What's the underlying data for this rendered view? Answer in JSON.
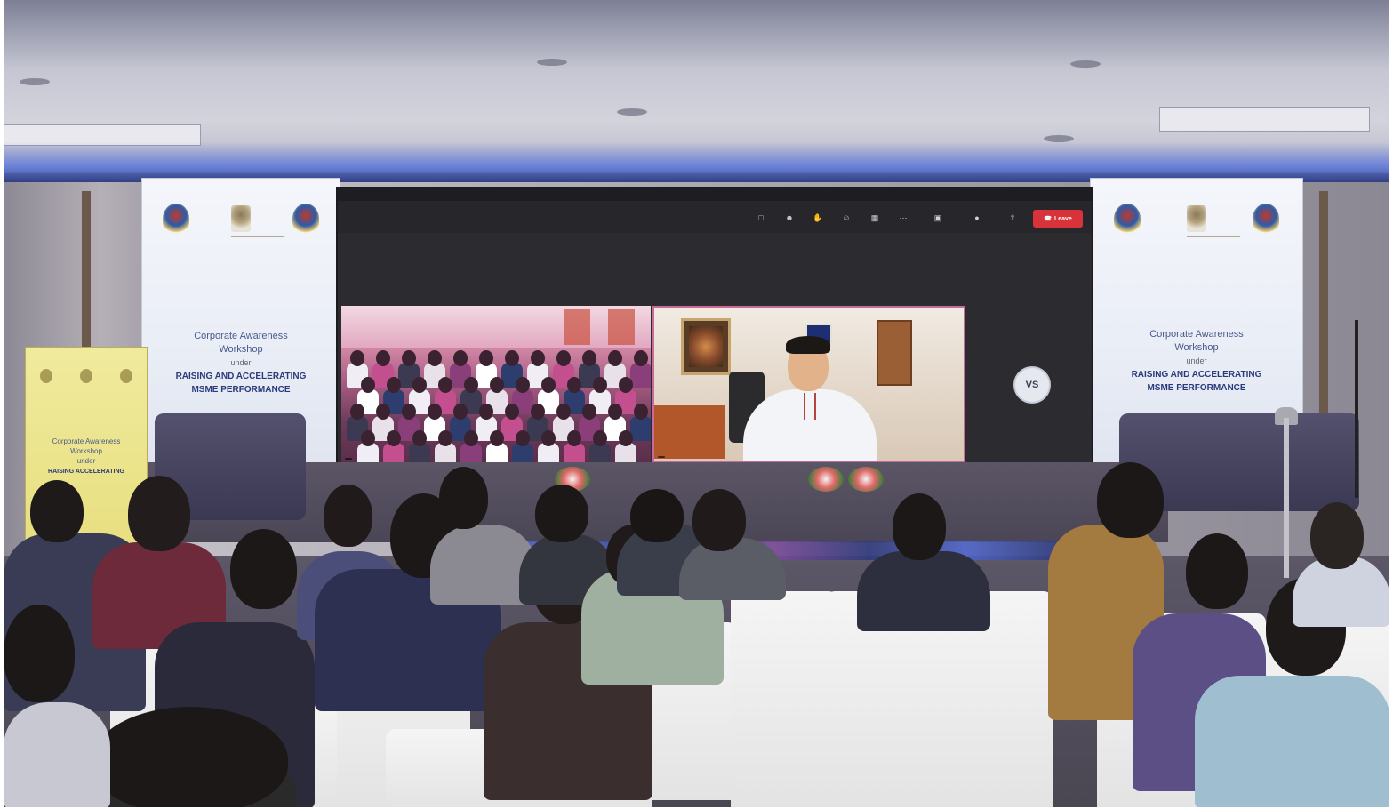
{
  "scene": {
    "description_alt": "",
    "colors": {
      "ceiling": "#c5c6d2",
      "led_blue": "#5064c8",
      "leave_red": "#d8323b",
      "banner_text": "#4b5a8c"
    }
  },
  "banner_left": {
    "line1": "Corporate Awareness",
    "line2": "Workshop",
    "line3": "under",
    "line4": "RAISING AND ACCELERATING",
    "line5": "MSME PERFORMANCE"
  },
  "banner_right": {
    "line1": "Corporate Awareness",
    "line2": "Workshop",
    "line3": "under",
    "line4": "RAISING AND ACCELERATING",
    "line5": "MSME PERFORMANCE"
  },
  "podium": {
    "line1": "Corporate Awareness",
    "line2": "Workshop",
    "line3": "under",
    "line4": "RAISING ACCELERATING"
  },
  "meeting": {
    "avatar_initials": "VS",
    "leave_label": "Leave"
  }
}
